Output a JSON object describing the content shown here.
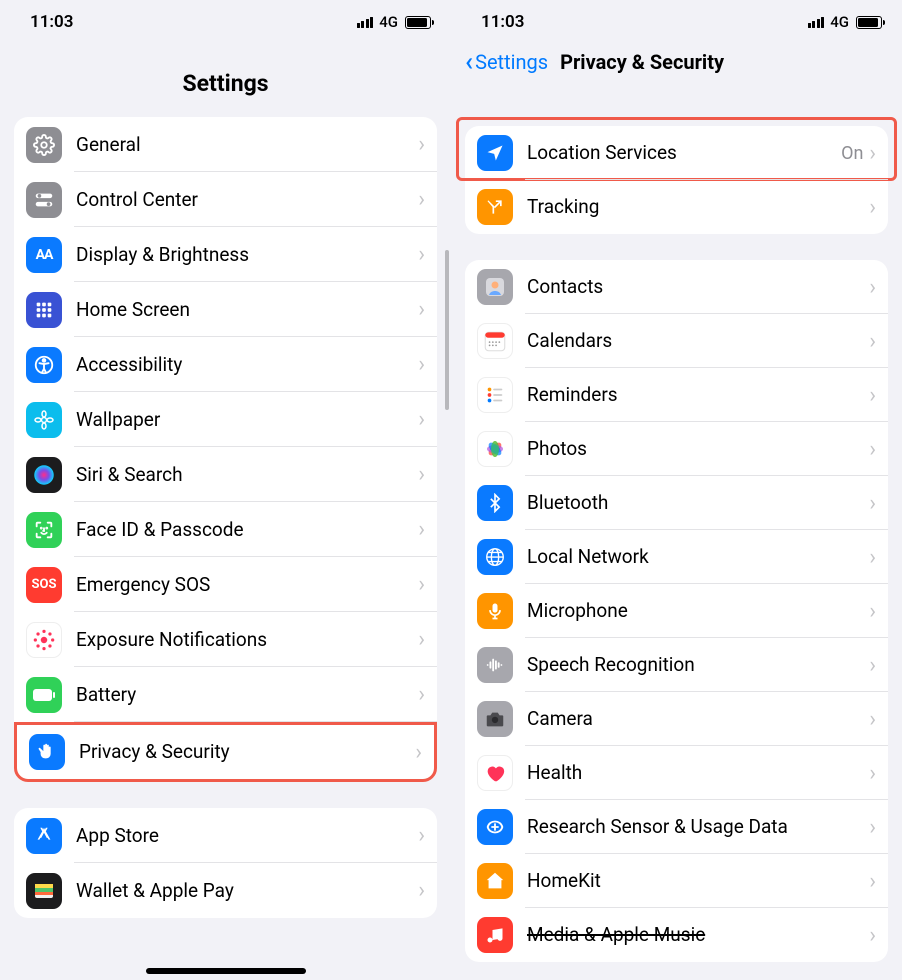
{
  "status": {
    "time": "11:03",
    "carrier": "4G"
  },
  "left": {
    "title": "Settings",
    "group1": [
      {
        "id": "general",
        "label": "General"
      },
      {
        "id": "control-center",
        "label": "Control Center"
      },
      {
        "id": "display-brightness",
        "label": "Display & Brightness"
      },
      {
        "id": "home-screen",
        "label": "Home Screen"
      },
      {
        "id": "accessibility",
        "label": "Accessibility"
      },
      {
        "id": "wallpaper",
        "label": "Wallpaper"
      },
      {
        "id": "siri-search",
        "label": "Siri & Search"
      },
      {
        "id": "faceid-passcode",
        "label": "Face ID & Passcode"
      },
      {
        "id": "emergency-sos",
        "label": "Emergency SOS"
      },
      {
        "id": "exposure-notifications",
        "label": "Exposure Notifications"
      },
      {
        "id": "battery",
        "label": "Battery"
      },
      {
        "id": "privacy-security",
        "label": "Privacy & Security"
      }
    ],
    "group2": [
      {
        "id": "app-store",
        "label": "App Store"
      },
      {
        "id": "wallet-apple-pay",
        "label": "Wallet & Apple Pay"
      }
    ]
  },
  "right": {
    "back": "Settings",
    "title": "Privacy & Security",
    "group1": [
      {
        "id": "location-services",
        "label": "Location Services",
        "value": "On"
      },
      {
        "id": "tracking",
        "label": "Tracking"
      }
    ],
    "group2": [
      {
        "id": "contacts",
        "label": "Contacts"
      },
      {
        "id": "calendars",
        "label": "Calendars"
      },
      {
        "id": "reminders",
        "label": "Reminders"
      },
      {
        "id": "photos",
        "label": "Photos"
      },
      {
        "id": "bluetooth",
        "label": "Bluetooth"
      },
      {
        "id": "local-network",
        "label": "Local Network"
      },
      {
        "id": "microphone",
        "label": "Microphone"
      },
      {
        "id": "speech-recognition",
        "label": "Speech Recognition"
      },
      {
        "id": "camera",
        "label": "Camera"
      },
      {
        "id": "health",
        "label": "Health"
      },
      {
        "id": "research-sensor",
        "label": "Research Sensor & Usage Data"
      },
      {
        "id": "homekit",
        "label": "HomeKit"
      },
      {
        "id": "media-apple-music",
        "label": "Media & Apple Music"
      }
    ]
  }
}
